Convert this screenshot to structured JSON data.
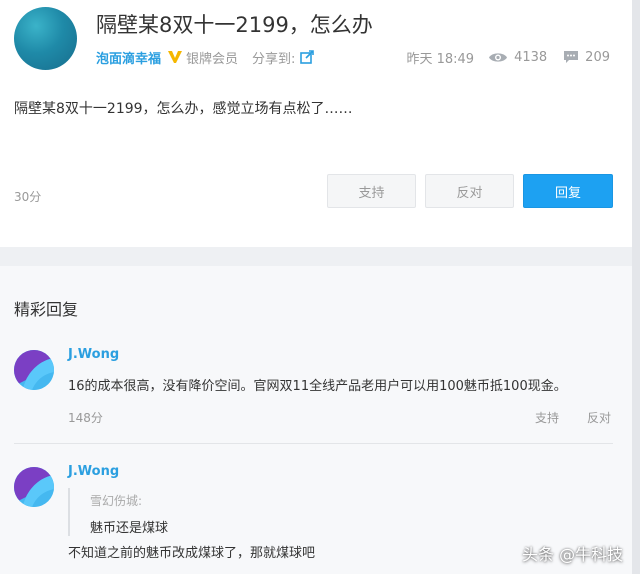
{
  "post": {
    "title": "隔壁某8双十一2199，怎么办",
    "author": "泡面滴幸福",
    "member_level": "银牌会员",
    "share_label": "分享到:",
    "time": "昨天 18:49",
    "views": "4138",
    "comments": "209",
    "body": "隔壁某8双十一2199，怎么办，感觉立场有点松了……",
    "score": "30分",
    "support_label": "支持",
    "oppose_label": "反对",
    "reply_label": "回复"
  },
  "replies_section": {
    "title": "精彩回复",
    "replies": [
      {
        "user": "J.Wong",
        "text": "16的成本很高，没有降价空间。官网双11全线产品老用户可以用100魅币抵100现金。",
        "score": "148分",
        "support_label": "支持",
        "oppose_label": "反对"
      },
      {
        "user": "J.Wong",
        "quote_user": "雪幻伤城:",
        "quote_text": "魅币还是煤球",
        "text": "不知道之前的魅币改成煤球了，那就煤球吧"
      }
    ]
  },
  "watermark": "头条 @牛科技",
  "icons": {
    "vip": "vip-badge-icon",
    "share": "share-icon",
    "views": "eye-icon",
    "comments": "chat-bubble-icon"
  },
  "colors": {
    "accent": "#1da1f2",
    "link": "#2b9fe0",
    "badge": "#f5b700"
  }
}
